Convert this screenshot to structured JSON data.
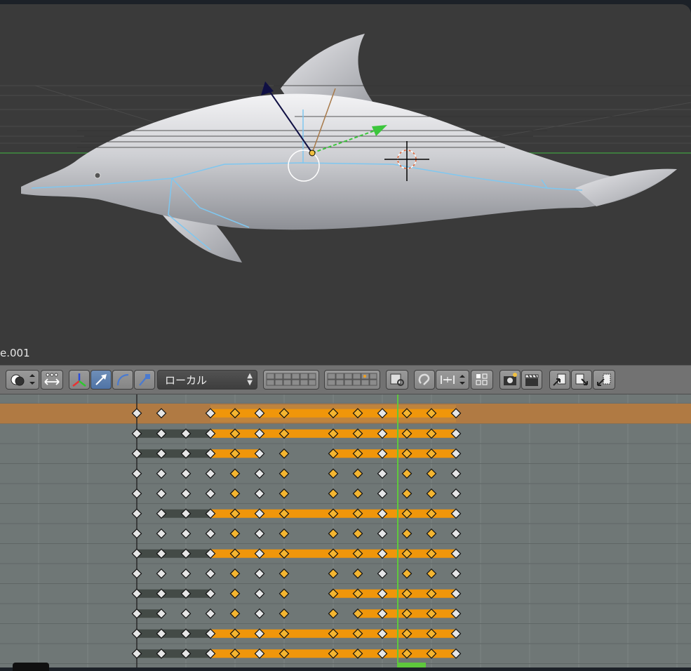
{
  "viewport": {
    "object_name": "e.001",
    "background": "#3a3a3a",
    "model": "dolphin"
  },
  "header": {
    "transform_space": {
      "value": "ローカル"
    },
    "icons": [
      "view-layers-icon",
      "manipulator-toggle-icon",
      "axis-manipulator-icon",
      "translate-manipulator-icon",
      "rotate-manipulator-icon",
      "scale-manipulator-icon",
      "layers-grid-icon",
      "layers-grid-2-icon",
      "lock-layers-icon",
      "proportional-edit-icon",
      "snap-element-icon",
      "snap-target-icon",
      "render-icon",
      "clapperboard-icon",
      "copy-pose-icon",
      "paste-pose-icon",
      "paste-flipped-icon"
    ]
  },
  "dopesheet": {
    "colors": {
      "summary_row": "#b07a43",
      "hold": "#f0960a",
      "inactive_hold": "#434a46",
      "key_selected": "#f4b530",
      "key_normal": "#e6e6e6",
      "current_frame": "#5ec83c",
      "background": "#6f7776"
    },
    "row_count": 13,
    "key_columns": 14,
    "current_frame_column": 11
  }
}
